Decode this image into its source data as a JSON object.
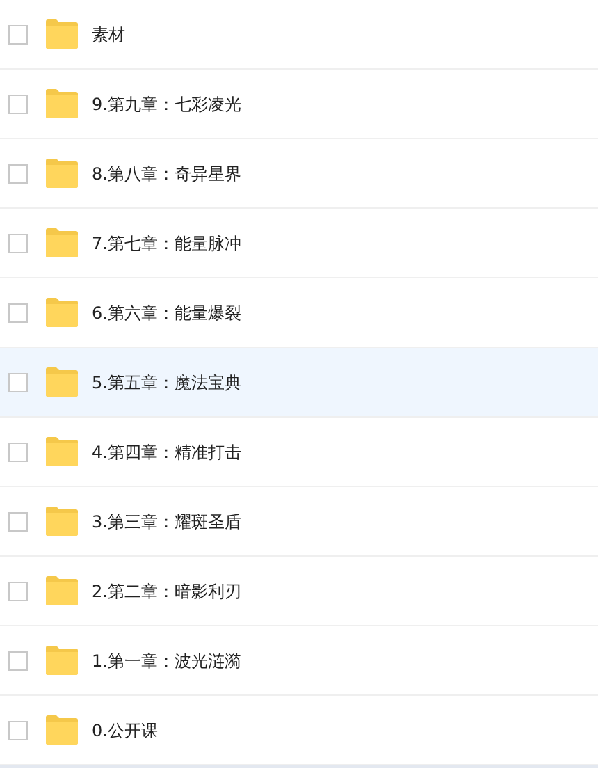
{
  "files": [
    {
      "name": "素材",
      "checked": false,
      "selected": false
    },
    {
      "name": "9.第九章：七彩凌光",
      "checked": false,
      "selected": false
    },
    {
      "name": "8.第八章：奇异星界",
      "checked": false,
      "selected": false
    },
    {
      "name": "7.第七章：能量脉冲",
      "checked": false,
      "selected": false
    },
    {
      "name": "6.第六章：能量爆裂",
      "checked": false,
      "selected": false
    },
    {
      "name": "5.第五章：魔法宝典",
      "checked": false,
      "selected": true
    },
    {
      "name": "4.第四章：精准打击",
      "checked": false,
      "selected": false
    },
    {
      "name": "3.第三章：耀斑圣盾",
      "checked": false,
      "selected": false
    },
    {
      "name": "2.第二章：暗影利刃",
      "checked": false,
      "selected": false
    },
    {
      "name": "1.第一章：波光涟漪",
      "checked": false,
      "selected": false
    },
    {
      "name": "0.公开课",
      "checked": false,
      "selected": false
    }
  ]
}
